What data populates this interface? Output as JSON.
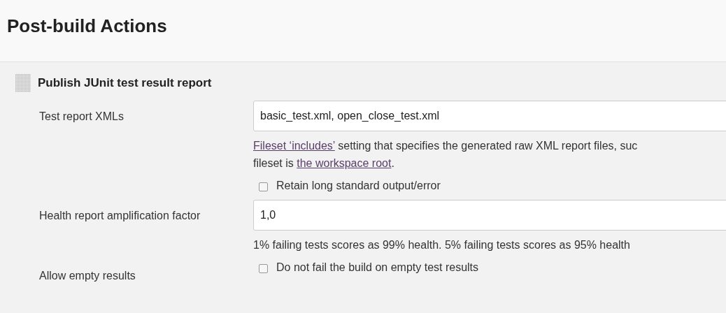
{
  "section_title": "Post-build Actions",
  "action": {
    "title": "Publish JUnit test result report",
    "fields": [
      {
        "kind": "text",
        "label": "Test report XMLs",
        "value": "basic_test.xml, open_close_test.xml",
        "help_lines": [
          [
            {
              "kind": "link",
              "text": "Fileset ‘includes’"
            },
            {
              "kind": "text",
              "text": " setting that specifies the generated raw XML report files, suc"
            }
          ],
          [
            {
              "kind": "text",
              "text": "fileset is "
            },
            {
              "kind": "link",
              "text": "the workspace root"
            },
            {
              "kind": "text",
              "text": "."
            }
          ]
        ]
      },
      {
        "kind": "checkbox",
        "label": "Retain long standard output/error",
        "checked": false
      },
      {
        "kind": "text",
        "label": "Health report amplification factor",
        "value": "1,0",
        "help_lines": [
          [
            {
              "kind": "text",
              "text": "1% failing tests scores as 99% health. 5% failing tests scores as 95% health"
            }
          ]
        ]
      },
      {
        "kind": "checkbox",
        "caption": "Allow empty results",
        "label": "Do not fail the build on empty test results",
        "checked": false
      }
    ]
  }
}
